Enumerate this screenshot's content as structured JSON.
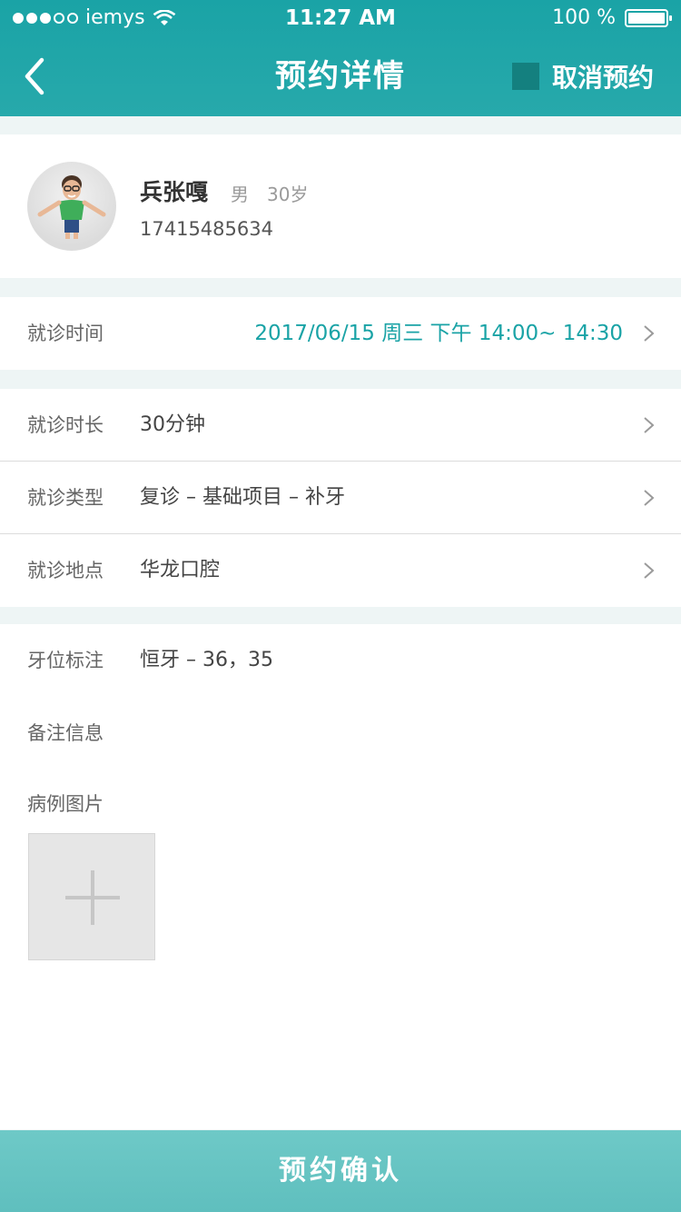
{
  "status_bar": {
    "carrier": "iemys",
    "time": "11:27 AM",
    "battery": "100 %"
  },
  "nav": {
    "title": "预约详情",
    "cancel_label": "取消预约"
  },
  "patient": {
    "name": "兵张嘎",
    "gender": "男",
    "age": "30岁",
    "phone": "17415485634"
  },
  "visit_time": {
    "label": "就诊时间",
    "value": "2017/06/15  周三   下午 14:00~ 14:30"
  },
  "details": {
    "duration": {
      "label": "就诊时长",
      "value": "30分钟"
    },
    "type": {
      "label": "就诊类型",
      "value": "复诊 – 基础项目 – 补牙"
    },
    "location": {
      "label": "就诊地点",
      "value": "华龙口腔"
    }
  },
  "extra": {
    "tooth": {
      "label": "牙位标注",
      "value": "恒牙 – 36，35"
    },
    "note": {
      "label": "备注信息",
      "value": ""
    }
  },
  "photos": {
    "label": "病例图片"
  },
  "confirm_label": "预约确认",
  "colors": {
    "accent": "#1aa3a6",
    "button": "#62c1c0"
  }
}
